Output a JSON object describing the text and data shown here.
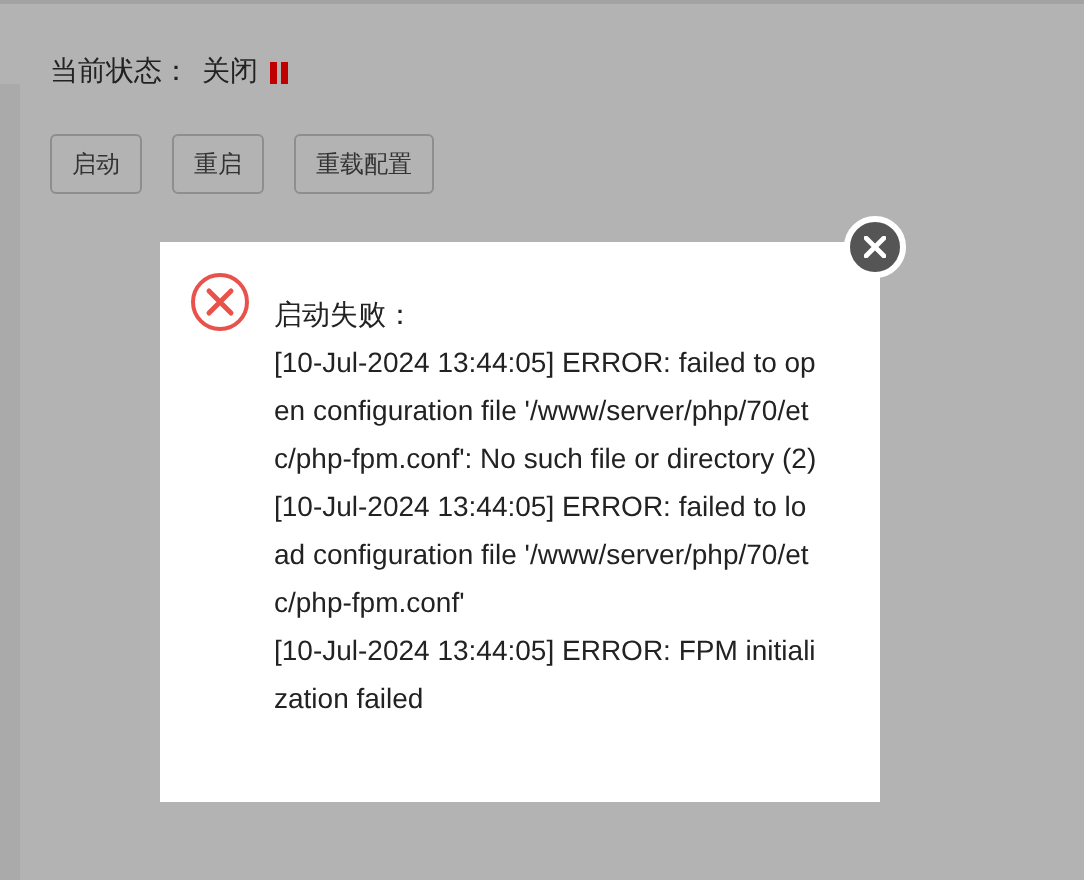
{
  "status": {
    "label": "当前状态：",
    "value": "关闭",
    "running": false
  },
  "buttons": [
    "启动",
    "重启",
    "重载配置"
  ],
  "dialog": {
    "title": "启动失败：",
    "lines": [
      "[10-Jul-2024 13:44:05] ERROR: failed to open configuration file '/www/server/php/70/etc/php-fpm.conf': No such file or directory (2)",
      "[10-Jul-2024 13:44:05] ERROR: failed to load configuration file '/www/server/php/70/etc/php-fpm.conf'",
      "[10-Jul-2024 13:44:05] ERROR: FPM initialization failed"
    ]
  }
}
